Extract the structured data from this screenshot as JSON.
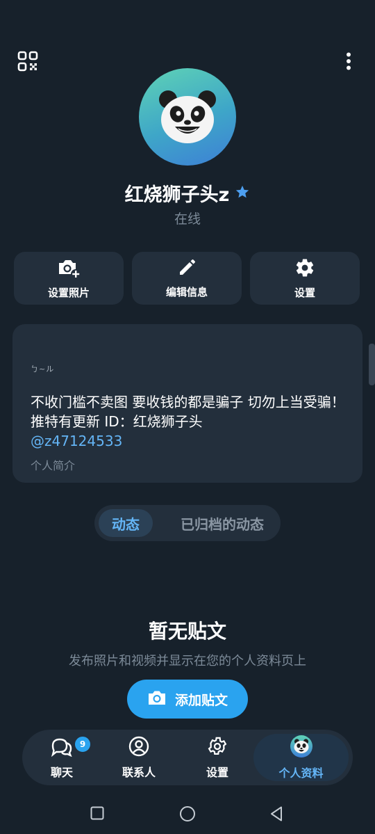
{
  "header": {
    "qr_icon": "qr-code-icon",
    "more_icon": "more-vertical-icon"
  },
  "profile": {
    "name": "红烧狮子头z",
    "verified_icon": "star-icon",
    "status": "在线",
    "avatar_icon": "panda-face-icon"
  },
  "actions": [
    {
      "label": "设置照片",
      "icon": "add-photo-icon"
    },
    {
      "label": "编辑信息",
      "icon": "pencil-icon"
    },
    {
      "label": "设置",
      "icon": "gear-icon"
    }
  ],
  "bio": {
    "handle_small": "ㄅ~ル",
    "text": "不收门槛不卖图 要收钱的都是骗子 切勿上当受骗！推特有更新 ID：红烧狮子头",
    "mention": "@z47124533",
    "label": "个人简介"
  },
  "tabs": {
    "posts": "动态",
    "archived": "已归档的动态"
  },
  "empty": {
    "title": "暂无贴文",
    "subtitle": "发布照片和视频并显示在您的个人资料页上",
    "button": "添加贴文"
  },
  "bottom_nav": {
    "chats": "聊天",
    "chats_badge": "9",
    "contacts": "联系人",
    "settings": "设置",
    "profile": "个人资料"
  },
  "colors": {
    "accent": "#2aa3ef",
    "link": "#64b5f6",
    "background": "#17212b",
    "card": "#232f3c"
  }
}
